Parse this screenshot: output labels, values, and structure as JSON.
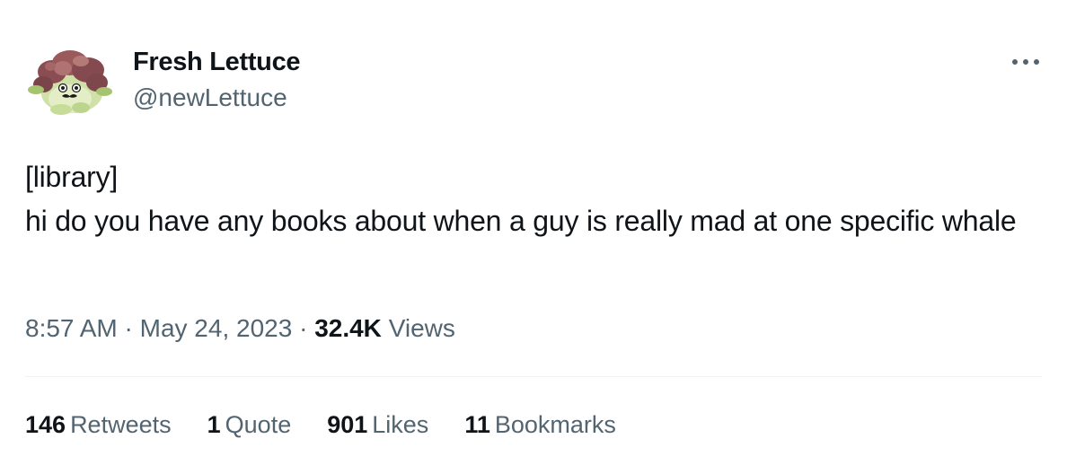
{
  "author": {
    "display_name": "Fresh Lettuce",
    "handle": "@newLettuce",
    "avatar_icon": "lettuce-avatar-icon"
  },
  "tweet": {
    "text": "[library]\nhi do you have any books about when a guy is really mad at one specific whale",
    "time": "8:57 AM",
    "separator": "·",
    "date": "May 24, 2023",
    "views_count": "32.4K",
    "views_label": "Views"
  },
  "stats": {
    "retweets_count": "146",
    "retweets_label": "Retweets",
    "quotes_count": "1",
    "quotes_label": "Quote",
    "likes_count": "901",
    "likes_label": "Likes",
    "bookmarks_count": "11",
    "bookmarks_label": "Bookmarks"
  },
  "colors": {
    "text_primary": "#0f1419",
    "text_secondary": "#536471",
    "divider": "#eff3f4"
  },
  "more_icon": "more-dots-icon"
}
